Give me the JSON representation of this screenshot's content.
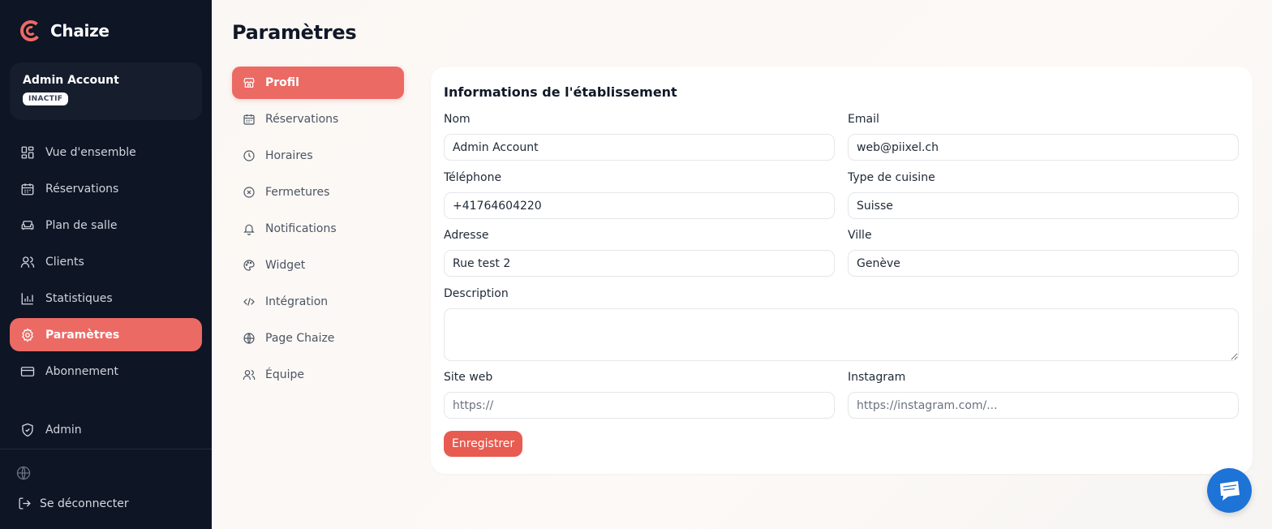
{
  "brand": {
    "name": "Chaize",
    "accent": "#ec6a64"
  },
  "account": {
    "name": "Admin Account",
    "status": "INACTIF"
  },
  "sidebar": {
    "items": [
      {
        "label": "Vue d'ensemble",
        "icon": "dashboard-icon",
        "active": false
      },
      {
        "label": "Réservations",
        "icon": "calendar-icon",
        "active": false
      },
      {
        "label": "Plan de salle",
        "icon": "sofa-icon",
        "active": false
      },
      {
        "label": "Clients",
        "icon": "users-icon",
        "active": false
      },
      {
        "label": "Statistiques",
        "icon": "bar-chart-icon",
        "active": false
      },
      {
        "label": "Paramètres",
        "icon": "gear-icon",
        "active": true
      },
      {
        "label": "Abonnement",
        "icon": "credit-card-icon",
        "active": false
      }
    ],
    "admin_label": "Admin",
    "logout_label": "Se déconnecter"
  },
  "page": {
    "title": "Paramètres"
  },
  "subnav": {
    "items": [
      {
        "label": "Profil",
        "icon": "store-icon",
        "active": true
      },
      {
        "label": "Réservations",
        "icon": "calendar-icon",
        "active": false
      },
      {
        "label": "Horaires",
        "icon": "clock-icon",
        "active": false
      },
      {
        "label": "Fermetures",
        "icon": "x-circle-icon",
        "active": false
      },
      {
        "label": "Notifications",
        "icon": "bell-icon",
        "active": false
      },
      {
        "label": "Widget",
        "icon": "palette-icon",
        "active": false
      },
      {
        "label": "Intégration",
        "icon": "code-icon",
        "active": false
      },
      {
        "label": "Page Chaize",
        "icon": "globe-icon",
        "active": false
      },
      {
        "label": "Équipe",
        "icon": "users-icon",
        "active": false
      }
    ]
  },
  "form": {
    "title": "Informations de l'établissement",
    "nom": {
      "label": "Nom",
      "value": "Admin Account"
    },
    "email": {
      "label": "Email",
      "value": "web@piixel.ch"
    },
    "telephone": {
      "label": "Téléphone",
      "value": "+41764604220"
    },
    "cuisine": {
      "label": "Type de cuisine",
      "value": "Suisse"
    },
    "adresse": {
      "label": "Adresse",
      "value": "Rue test 2"
    },
    "ville": {
      "label": "Ville",
      "value": "Genève"
    },
    "description": {
      "label": "Description",
      "value": ""
    },
    "site_web": {
      "label": "Site web",
      "value": "",
      "placeholder": "https://"
    },
    "instagram": {
      "label": "Instagram",
      "value": "",
      "placeholder": "https://instagram.com/..."
    },
    "save_label": "Enregistrer"
  }
}
